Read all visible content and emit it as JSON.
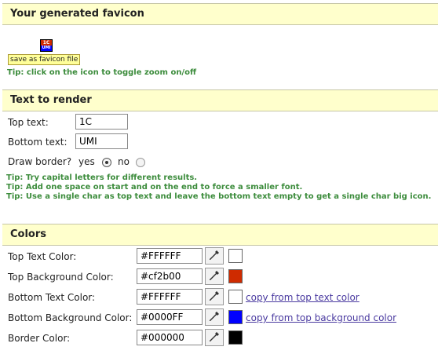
{
  "favicon_section": {
    "title": "Your generated favicon",
    "save_label": "save as favicon file",
    "tip": "Tip: click on the icon to toggle zoom on/off",
    "icon_top": "1C",
    "icon_bottom": "UMI"
  },
  "text_section": {
    "title": "Text to render",
    "top_label": "Top text:",
    "top_value": "1C",
    "bottom_label": "Bottom text:",
    "bottom_value": "UMI",
    "border_label": "Draw border?",
    "yes_label": "yes",
    "no_label": "no",
    "border_selected": "yes",
    "tips": [
      "Tip: Try capital letters for different results.",
      "Tip: Add one space on start and on the end to force a smaller font.",
      "Tip: Use a single char as top text and leave the bottom text empty to get a single char big icon."
    ]
  },
  "colors_section": {
    "title": "Colors",
    "rows": [
      {
        "label": "Top Text Color:",
        "value": "#FFFFFF",
        "swatch": "#ffffff",
        "link": ""
      },
      {
        "label": "Top Background Color:",
        "value": "#cf2b00",
        "swatch": "#cf2b00",
        "link": ""
      },
      {
        "label": "Bottom Text Color:",
        "value": "#FFFFFF",
        "swatch": "#ffffff",
        "link": "copy from top text color"
      },
      {
        "label": "Bottom Background Color:",
        "value": "#0000FF",
        "swatch": "#0000ff",
        "link": "copy from top background color"
      },
      {
        "label": "Border Color:",
        "value": "#000000",
        "swatch": "#000000",
        "link": ""
      }
    ]
  },
  "colors": {
    "header_bg": "#ffffcc",
    "tip_green": "#3c8c3c",
    "link_purple": "#4a3aa0"
  }
}
